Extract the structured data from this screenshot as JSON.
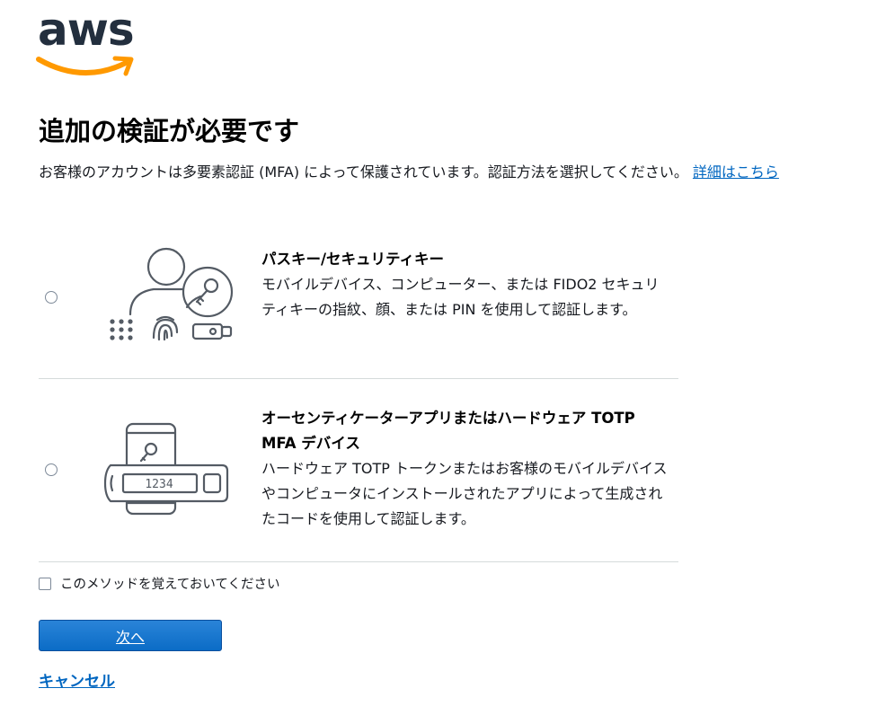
{
  "brand": {
    "logo_text": "aws",
    "smile_color": "#ff9900",
    "text_color": "#232f3e"
  },
  "header": {
    "title": "追加の検証が必要です"
  },
  "description": {
    "text": "お客様のアカウントは多要素認証 (MFA) によって保護されています。認証方法を選択してください。",
    "link_label": "詳細はこちら"
  },
  "options": [
    {
      "title": "パスキー/セキュリティキー",
      "description": "モバイルデバイス、コンピューター、または FIDO2 セキュリティキーの指紋、顔、または PIN を使用して認証します。",
      "selected": false,
      "icon": "passkey-illustration"
    },
    {
      "title": "オーセンティケーターアプリまたはハードウェア TOTP MFA デバイス",
      "description": "ハードウェア TOTP トークンまたはお客様のモバイルデバイスやコンピュータにインストールされたアプリによって生成されたコードを使用して認証します。",
      "selected": false,
      "icon": "authenticator-illustration",
      "token_display": "1234"
    }
  ],
  "remember": {
    "label": "このメソッドを覚えておいてください",
    "checked": false
  },
  "actions": {
    "next_label": "次へ",
    "cancel_label": "キャンセル"
  },
  "colors": {
    "link": "#0066c0",
    "primary_button": "#0b6cc6",
    "divider": "#d5dbdb",
    "illustration_stroke": "#545b64"
  }
}
